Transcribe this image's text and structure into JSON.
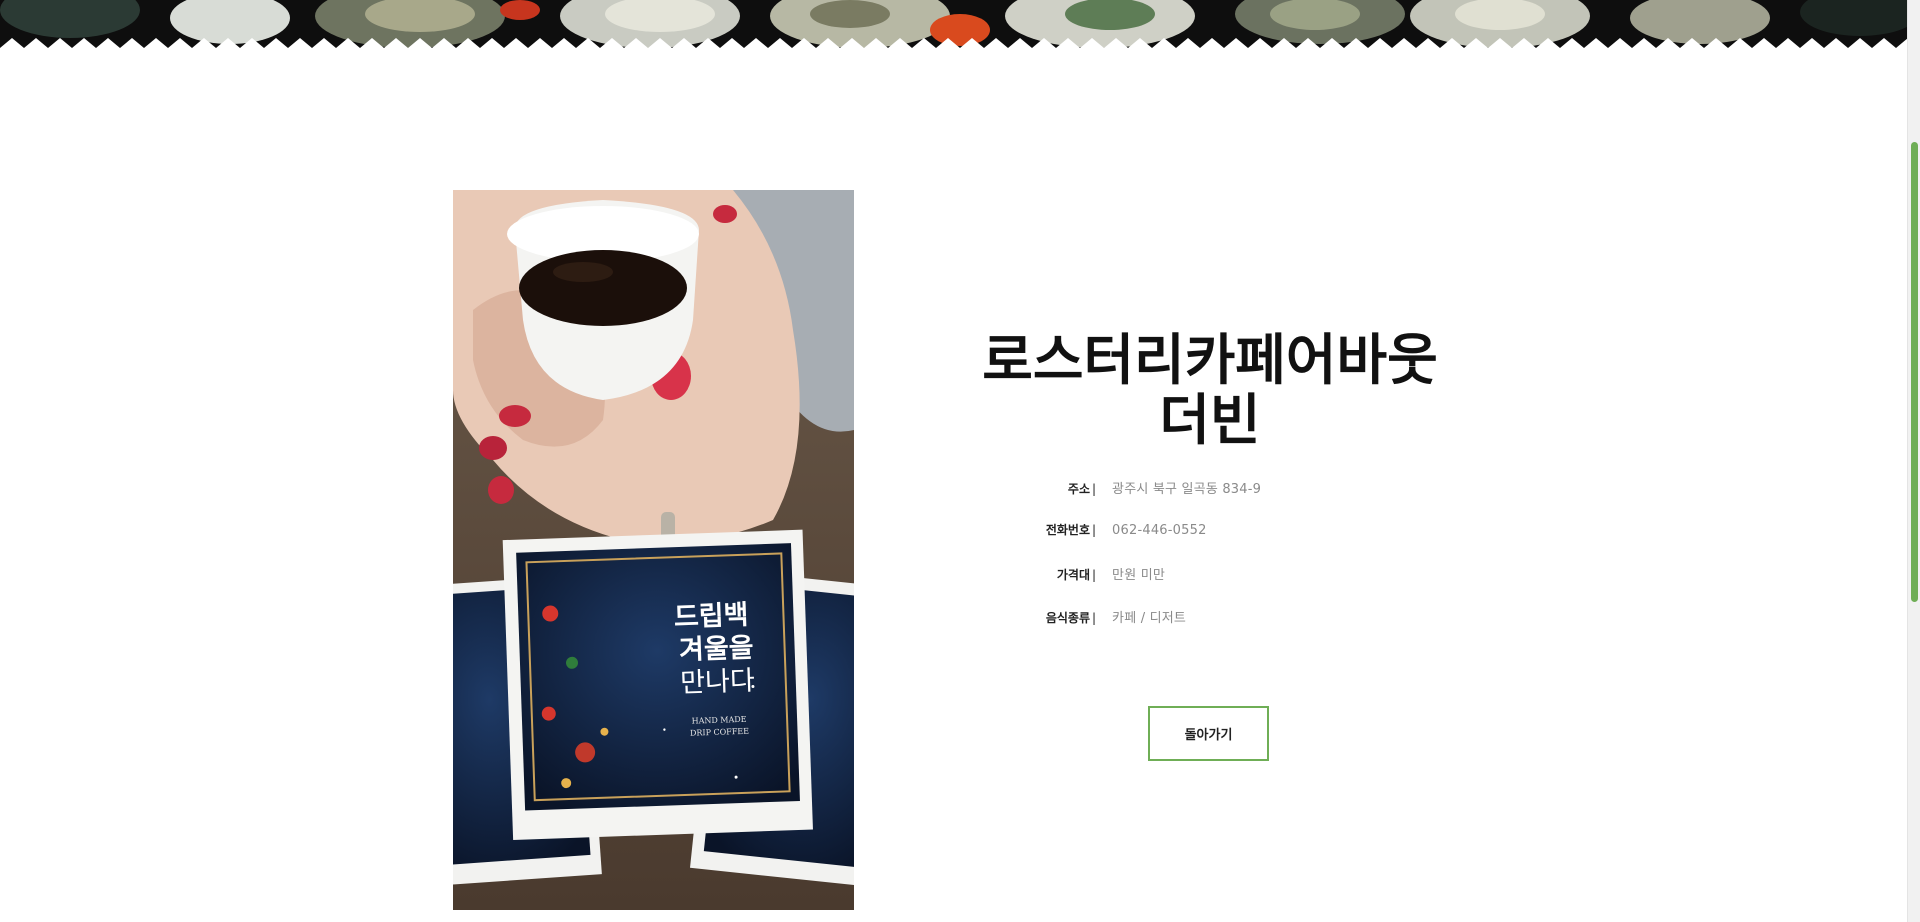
{
  "restaurant": {
    "title_line1": "로스터리카페어바웃",
    "title_line2": "더빈",
    "details": [
      {
        "label": "주소",
        "separator": "|",
        "value": "광주시 북구 일곡동 834-9"
      },
      {
        "label": "전화번호",
        "separator": "|",
        "value": "062-446-0552"
      },
      {
        "label": "가격대",
        "separator": "|",
        "value": "만원 미만"
      },
      {
        "label": "음식종류",
        "separator": "|",
        "value": "카페 / 디저트"
      }
    ]
  },
  "photo": {
    "packet_text_line1": "드립백",
    "packet_text_line2": "겨울을",
    "packet_text_line3": "만나다",
    "packet_subtext_line1": "HAND MADE",
    "packet_subtext_line2": "DRIP COFFEE"
  },
  "actions": {
    "back_label": "돌아가기"
  },
  "colors": {
    "accent": "#6fae56",
    "banner_dark": "#0e0e0e"
  }
}
